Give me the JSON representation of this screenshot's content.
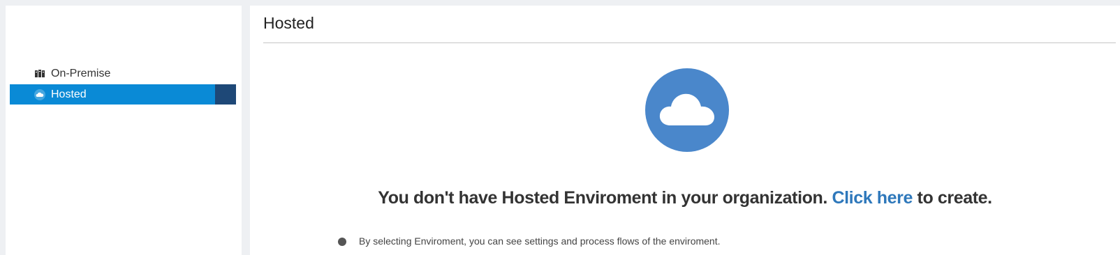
{
  "sidebar": {
    "items": [
      {
        "label": "On-Premise",
        "icon": "server-stack-icon",
        "active": false
      },
      {
        "label": "Hosted",
        "icon": "cloud-icon",
        "active": true
      }
    ]
  },
  "main": {
    "title": "Hosted",
    "hero_icon": "cloud-icon",
    "empty_message": {
      "before": "You don't have Hosted Enviroment in your organization. ",
      "link": "Click here",
      "after": " to create."
    },
    "hint": "By selecting Enviroment, you can see settings and process flows of the enviroment."
  },
  "colors": {
    "active_item_bg": "#0a8ad6",
    "active_marker": "#1e4877",
    "hero_circle": "#4a87cb",
    "link": "#2e78bb"
  }
}
